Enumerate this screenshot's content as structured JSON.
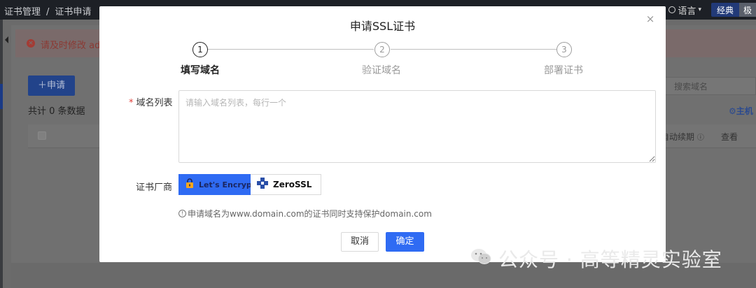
{
  "background": {
    "breadcrumb": [
      "证书管理",
      "证书申请"
    ],
    "breadcrumb_sep": "/",
    "language_label": "语言",
    "mode_classic": "经典",
    "mode_other": "极",
    "alert_text": "请及时修改 adı",
    "apply_button": "＋申请",
    "total_text": "共计 0 条数据",
    "search_placeholder": "搜索域名",
    "host_link": "⚙主机",
    "column_renew": "自动续期",
    "column_view": "查看"
  },
  "modal": {
    "title": "申请SSL证书",
    "close_symbol": "×",
    "steps": [
      {
        "number": "1",
        "label": "填写域名",
        "active": true
      },
      {
        "number": "2",
        "label": "验证域名",
        "active": false
      },
      {
        "number": "3",
        "label": "部署证书",
        "active": false
      }
    ],
    "domain_label": "域名列表",
    "required_mark": "*",
    "domain_placeholder": "请输入域名列表，每行一个",
    "domain_value": "",
    "vendor_label": "证书厂商",
    "vendors": [
      {
        "name": "Let's Encrypt",
        "selected": true
      },
      {
        "name": "ZeroSSL",
        "selected": false
      }
    ],
    "tip_text": "申请域名为www.domain.com的证书同时支持保护domain.com",
    "cancel_label": "取消",
    "confirm_label": "确定"
  },
  "colors": {
    "primary": "#2f6bf3",
    "required": "#e0413b"
  },
  "watermark": {
    "text": "公众号 · 高等精灵实验室"
  }
}
